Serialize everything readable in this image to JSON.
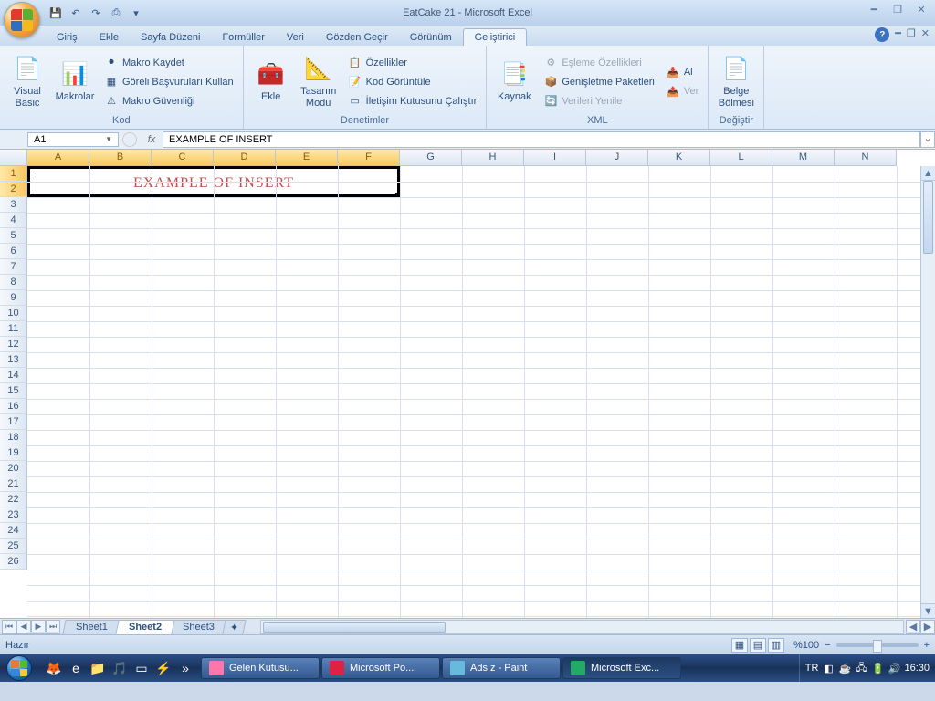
{
  "title": "EatCake 21 - Microsoft Excel",
  "qat_icons": [
    "save-icon",
    "undo-icon",
    "redo-icon",
    "quickprint-icon",
    "customize-icon"
  ],
  "tabs": [
    "Giriş",
    "Ekle",
    "Sayfa Düzeni",
    "Formüller",
    "Veri",
    "Gözden Geçir",
    "Görünüm",
    "Geliştirici"
  ],
  "active_tab": "Geliştirici",
  "ribbon": {
    "kod": {
      "label": "Kod",
      "vba": "Visual\nBasic",
      "macros": "Makrolar",
      "record": "Makro Kaydet",
      "relative": "Göreli Başvuruları Kullan",
      "security": "Makro Güvenliği"
    },
    "denetimler": {
      "label": "Denetimler",
      "insert": "Ekle",
      "design": "Tasarım\nModu",
      "props": "Özellikler",
      "viewcode": "Kod Görüntüle",
      "dialog": "İletişim Kutusunu Çalıştır"
    },
    "xml": {
      "label": "XML",
      "source": "Kaynak",
      "mapprops": "Eşleme Özellikleri",
      "expansion": "Genişletme Paketleri",
      "refresh": "Verileri Yenile",
      "al": "Al",
      "ver": "Ver"
    },
    "degistir": {
      "label": "Değiştir",
      "docpanel": "Belge\nBölmesi"
    }
  },
  "namebox": "A1",
  "formula": "EXAMPLE OF INSERT",
  "columns": [
    "A",
    "B",
    "C",
    "D",
    "E",
    "F",
    "G",
    "H",
    "I",
    "J",
    "K",
    "L",
    "M",
    "N"
  ],
  "selected_cols": [
    "A",
    "B",
    "C",
    "D",
    "E",
    "F"
  ],
  "rows": 26,
  "selected_rows": [
    1,
    2
  ],
  "merged_text": "EXAMPLE OF INSERT",
  "sheets": [
    "Sheet1",
    "Sheet2",
    "Sheet3"
  ],
  "active_sheet": "Sheet2",
  "status": "Hazır",
  "zoom": "%100",
  "taskbar": {
    "buttons": [
      {
        "label": "Gelen Kutusu...",
        "icon": "#f7a"
      },
      {
        "label": "Microsoft Po...",
        "icon": "#d24"
      },
      {
        "label": "Adsız - Paint",
        "icon": "#6bd"
      },
      {
        "label": "Microsoft Exc...",
        "icon": "#2a6",
        "active": true
      }
    ],
    "lang": "TR",
    "clock": "16:30"
  }
}
